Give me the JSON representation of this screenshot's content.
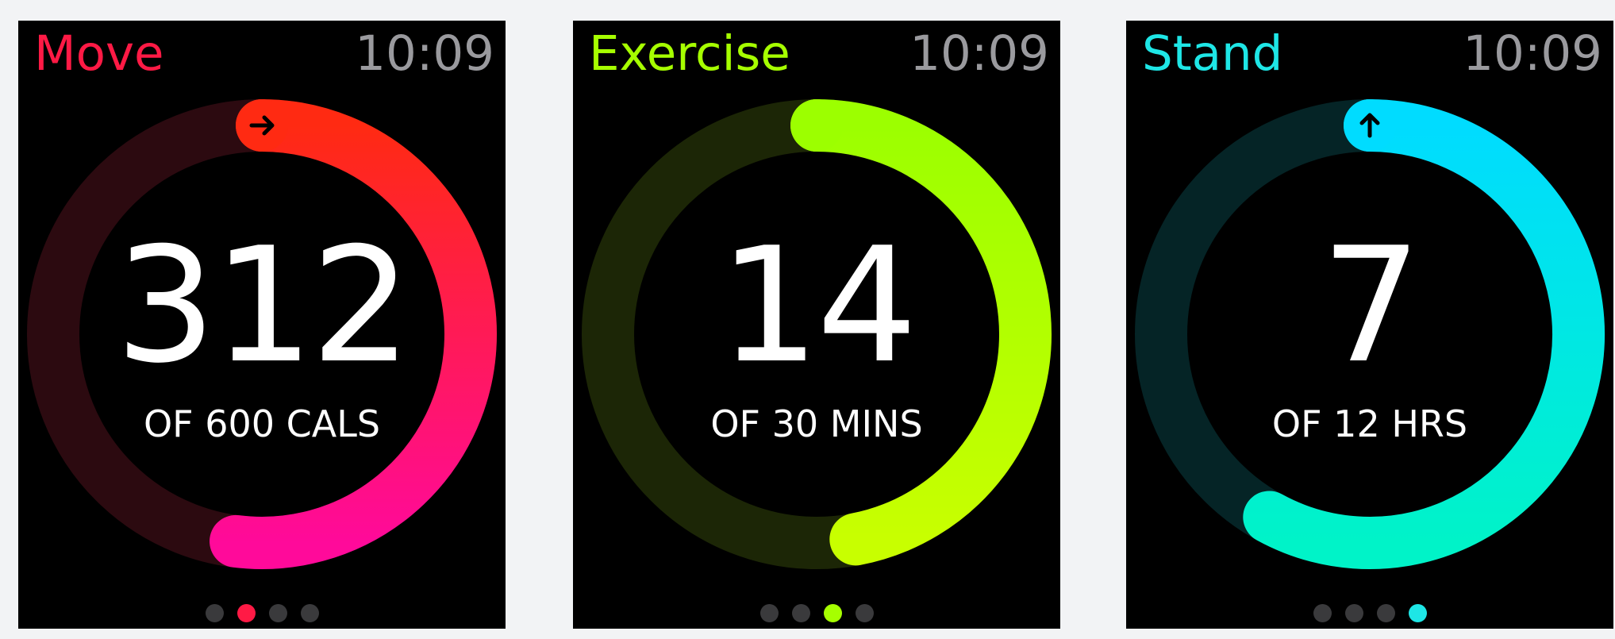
{
  "screens": [
    {
      "title": "Move",
      "time": "10:09",
      "value": "312",
      "goal": "OF 600 CALS",
      "ring_progress_fraction": 0.52,
      "colors": {
        "title": "#ff1a45",
        "ring_start": "#ff2a12",
        "ring_end": "#ff0a9a",
        "track": "#2c0a10",
        "indicator": "#000000"
      },
      "indicator_icon": "arrow-right-icon",
      "page_dots": 4,
      "active_dot": 1
    },
    {
      "title": "Exercise",
      "time": "10:09",
      "value": "14",
      "goal": "OF 30 MINS",
      "ring_progress_fraction": 0.47,
      "colors": {
        "title": "#a6ff00",
        "ring_start": "#9cff00",
        "ring_end": "#c8ff00",
        "track": "#1c2606",
        "indicator": "#000000"
      },
      "indicator_icon": "",
      "page_dots": 4,
      "active_dot": 2
    },
    {
      "title": "Stand",
      "time": "10:09",
      "value": "7",
      "goal": "OF 12 HRS",
      "ring_progress_fraction": 0.58,
      "colors": {
        "title": "#1ee6e6",
        "ring_start": "#00dcff",
        "ring_end": "#00f3c8",
        "track": "#052426",
        "indicator": "#000000"
      },
      "indicator_icon": "arrow-up-icon",
      "page_dots": 4,
      "active_dot": 3
    }
  ]
}
